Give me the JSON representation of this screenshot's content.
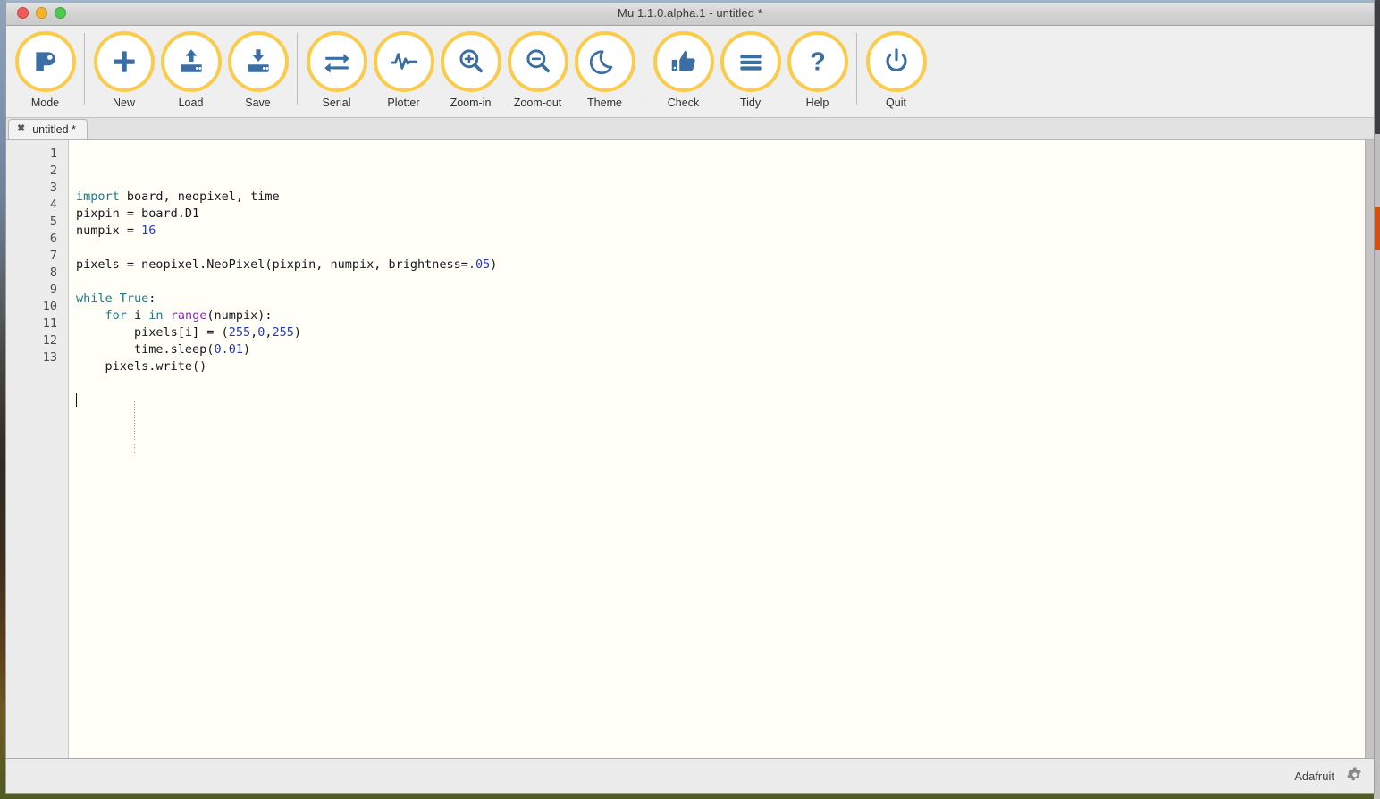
{
  "window": {
    "title": "Mu 1.1.0.alpha.1 - untitled *",
    "traffic": {
      "close": "close-button",
      "minimize": "minimize-button",
      "zoom": "zoom-button"
    }
  },
  "toolbar": {
    "items": [
      {
        "label": "Mode",
        "icon": "mode-icon"
      },
      {
        "label": "New",
        "icon": "new-icon"
      },
      {
        "label": "Load",
        "icon": "load-icon"
      },
      {
        "label": "Save",
        "icon": "save-icon"
      },
      {
        "label": "Serial",
        "icon": "serial-icon"
      },
      {
        "label": "Plotter",
        "icon": "plotter-icon"
      },
      {
        "label": "Zoom-in",
        "icon": "zoom-in-icon"
      },
      {
        "label": "Zoom-out",
        "icon": "zoom-out-icon"
      },
      {
        "label": "Theme",
        "icon": "theme-moon-icon"
      },
      {
        "label": "Check",
        "icon": "check-thumbs-up-icon"
      },
      {
        "label": "Tidy",
        "icon": "tidy-lines-icon"
      },
      {
        "label": "Help",
        "icon": "help-question-icon"
      },
      {
        "label": "Quit",
        "icon": "quit-power-icon"
      }
    ],
    "accent": "#fbcb4b",
    "icon_color": "#3b6ea5"
  },
  "tabs": [
    {
      "label": "untitled *",
      "close": "✖"
    }
  ],
  "editor": {
    "line_numbers": [
      "1",
      "2",
      "3",
      "4",
      "5",
      "6",
      "7",
      "8",
      "9",
      "10",
      "11",
      "12",
      "13"
    ],
    "lines": [
      {
        "n": 1,
        "tokens": [
          {
            "t": "import",
            "c": "kw"
          },
          {
            "t": " board, neopixel, time",
            "c": ""
          }
        ]
      },
      {
        "n": 2,
        "tokens": [
          {
            "t": "pixpin = board.D1",
            "c": ""
          }
        ]
      },
      {
        "n": 3,
        "tokens": [
          {
            "t": "numpix = ",
            "c": ""
          },
          {
            "t": "16",
            "c": "num"
          }
        ]
      },
      {
        "n": 4,
        "tokens": [
          {
            "t": "",
            "c": ""
          }
        ]
      },
      {
        "n": 5,
        "tokens": [
          {
            "t": "pixels = neopixel.NeoPixel(pixpin, numpix, brightness=",
            "c": ""
          },
          {
            "t": ".05",
            "c": "num"
          },
          {
            "t": ")",
            "c": ""
          }
        ]
      },
      {
        "n": 6,
        "tokens": [
          {
            "t": "",
            "c": ""
          }
        ]
      },
      {
        "n": 7,
        "tokens": [
          {
            "t": "while",
            "c": "kw"
          },
          {
            "t": " ",
            "c": ""
          },
          {
            "t": "True",
            "c": "kw"
          },
          {
            "t": ":",
            "c": ""
          }
        ]
      },
      {
        "n": 8,
        "tokens": [
          {
            "t": "    ",
            "c": ""
          },
          {
            "t": "for",
            "c": "kw"
          },
          {
            "t": " i ",
            "c": ""
          },
          {
            "t": "in",
            "c": "kw"
          },
          {
            "t": " ",
            "c": ""
          },
          {
            "t": "range",
            "c": "bi"
          },
          {
            "t": "(numpix):",
            "c": ""
          }
        ]
      },
      {
        "n": 9,
        "tokens": [
          {
            "t": "        pixels[i] = (",
            "c": ""
          },
          {
            "t": "255",
            "c": "num"
          },
          {
            "t": ",",
            "c": ""
          },
          {
            "t": "0",
            "c": "num"
          },
          {
            "t": ",",
            "c": ""
          },
          {
            "t": "255",
            "c": "num"
          },
          {
            "t": ")",
            "c": ""
          }
        ]
      },
      {
        "n": 10,
        "tokens": [
          {
            "t": "        time.sleep(",
            "c": ""
          },
          {
            "t": "0.01",
            "c": "num"
          },
          {
            "t": ")",
            "c": ""
          }
        ]
      },
      {
        "n": 11,
        "tokens": [
          {
            "t": "    pixels.write()",
            "c": ""
          }
        ]
      },
      {
        "n": 12,
        "tokens": [
          {
            "t": "",
            "c": ""
          }
        ]
      },
      {
        "n": 13,
        "tokens": [
          {
            "t": "",
            "c": "caret"
          }
        ]
      }
    ],
    "background": "#fffff8",
    "gutter_background": "#ececec",
    "keyword_color": "#1a7b88",
    "number_color": "#2339b3",
    "builtin_color": "#8a2bb0"
  },
  "statusbar": {
    "mode_label": "Adafruit",
    "gear_icon": "gear-icon"
  }
}
